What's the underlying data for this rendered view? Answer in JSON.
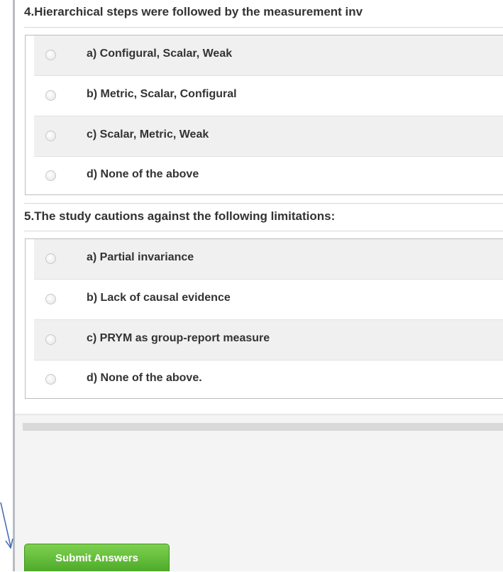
{
  "questions": [
    {
      "text": "4.Hierarchical steps were followed by the measurement inv",
      "options": [
        "a) Configural, Scalar, Weak",
        "b) Metric, Scalar, Configural",
        "c) Scalar, Metric, Weak",
        "d) None of the above"
      ]
    },
    {
      "text": "5.The study cautions against the following limitations:",
      "options": [
        "a) Partial invariance",
        "b) Lack of causal evidence",
        "c) PRYM as group-report measure",
        "d) None of the above."
      ]
    }
  ],
  "submit_label": "Submit Answers",
  "colors": {
    "submit_green": "#5cba35",
    "arrow_blue": "#3d66b3",
    "row_shade": "#f0f0f0"
  },
  "icons": {
    "radio": "radio-unchecked-icon",
    "arrow": "arrow-down-icon"
  }
}
